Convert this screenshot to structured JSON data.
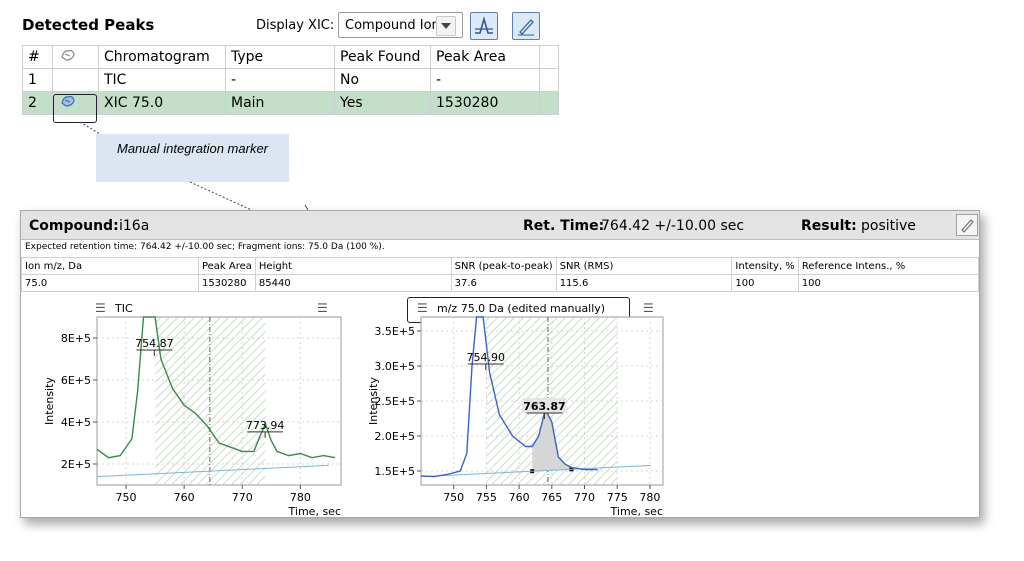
{
  "detected_peaks": {
    "title": "Detected Peaks",
    "display_xic_label": "Display XIC:",
    "display_xic_value": "Compound Ions",
    "columns": [
      "#",
      "",
      "Chromatogram",
      "Type",
      "Peak Found",
      "Peak Area"
    ],
    "rows": [
      {
        "num": "1",
        "chromatogram": "TIC",
        "type": "-",
        "peak_found": "No",
        "peak_area": "-"
      },
      {
        "num": "2",
        "chromatogram": "XIC 75.0",
        "type": "Main",
        "peak_found": "Yes",
        "peak_area": "1530280"
      }
    ],
    "callout": "Manual integration marker"
  },
  "compound": {
    "compound_label": "Compound:",
    "compound_value": "i16a",
    "ret_time_label": "Ret. Time:",
    "ret_time_value": "764.42 +/-10.00 sec",
    "result_label": "Result:",
    "result_value": "positive",
    "expected_text": "Expected retention time: 764.42 +/-10.00 sec; Fragment ions: 75.0 Da (100 %).",
    "ion_table": {
      "headers": [
        "Ion m/z, Da",
        "Peak Area",
        "Height",
        "SNR (peak-to-peak)",
        "SNR (RMS)",
        "Intensity, %",
        "Reference Intens., %"
      ],
      "row": [
        "75.0",
        "1530280",
        "85440",
        "37.6",
        "115.6",
        "100",
        "100"
      ]
    }
  },
  "chart_data": [
    {
      "type": "line",
      "title": "TIC",
      "xlabel": "Time, sec",
      "ylabel": "Intensity",
      "xlim": [
        745,
        787
      ],
      "ylim": [
        100000,
        900000
      ],
      "x_ticks": [
        "750",
        "760",
        "770",
        "780"
      ],
      "y_ticks": [
        "2E+5",
        "4E+5",
        "6E+5",
        "8E+5"
      ],
      "series": [
        {
          "x": [
            745,
            747,
            749,
            751,
            752,
            753,
            754,
            755,
            756,
            758,
            760,
            762,
            764,
            766,
            768,
            770,
            772,
            773,
            774,
            775,
            776,
            778,
            780,
            782,
            784,
            786
          ],
          "y": [
            270000,
            230000,
            240000,
            320000,
            550000,
            900000,
            900000,
            900000,
            700000,
            560000,
            480000,
            440000,
            380000,
            300000,
            280000,
            260000,
            260000,
            330000,
            390000,
            310000,
            260000,
            240000,
            250000,
            230000,
            240000,
            230000
          ]
        }
      ],
      "peak_labels": [
        {
          "x": 754.87,
          "label": "754.87"
        },
        {
          "x": 773.94,
          "label": "773.94"
        }
      ],
      "integration_window": [
        755,
        774
      ],
      "retention_marker": 764.42
    },
    {
      "type": "line",
      "title": "m/z 75.0 Da (edited manually)",
      "xlabel": "Time, sec",
      "ylabel": "Intensity",
      "xlim": [
        745,
        782
      ],
      "ylim": [
        130000,
        370000
      ],
      "x_ticks": [
        "750",
        "755",
        "760",
        "765",
        "770",
        "775",
        "780"
      ],
      "y_ticks": [
        "1.5E+5",
        "2.0E+5",
        "2.5E+5",
        "3.0E+5",
        "3.5E+5"
      ],
      "series": [
        {
          "x": [
            745,
            747,
            749,
            751,
            752,
            752.8,
            753.5,
            754.5,
            755.5,
            757,
            759,
            761,
            762,
            763,
            764,
            765,
            766,
            767,
            768,
            770,
            772
          ],
          "y": [
            143000,
            142000,
            145000,
            150000,
            175000,
            300000,
            370000,
            370000,
            290000,
            230000,
            200000,
            185000,
            185000,
            200000,
            238000,
            220000,
            170000,
            160000,
            155000,
            152000,
            152000
          ]
        }
      ],
      "peak_labels": [
        {
          "x": 754.9,
          "label": "754.90"
        },
        {
          "x": 763.87,
          "label": "763.87"
        }
      ],
      "integration_window": [
        755,
        775
      ],
      "retention_marker": 764.42,
      "manual_peak_range": [
        762,
        768
      ]
    }
  ]
}
